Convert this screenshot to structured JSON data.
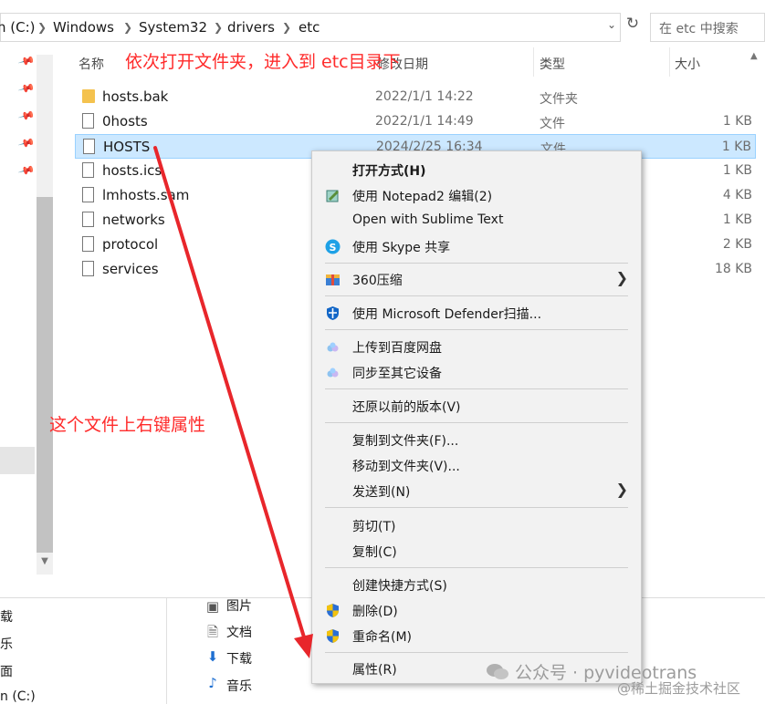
{
  "address": {
    "crumbs": [
      "n (C:)",
      "Windows",
      "System32",
      "drivers",
      "etc"
    ],
    "search_placeholder": "在 etc 中搜索"
  },
  "columns": {
    "name": "名称",
    "date": "修改日期",
    "type": "类型",
    "size": "大小"
  },
  "files": [
    {
      "name": "hosts.bak",
      "date": "2022/1/1 14:22",
      "type": "文件夹",
      "size": ""
    },
    {
      "name": "0hosts",
      "date": "2022/1/1 14:49",
      "type": "文件",
      "size": "1 KB"
    },
    {
      "name": "HOSTS",
      "date": "2024/2/25 16:34",
      "type": "文件",
      "size": "1 KB"
    },
    {
      "name": "hosts.ics",
      "date": "",
      "type": "",
      "size": "1 KB"
    },
    {
      "name": "lmhosts.sam",
      "date": "",
      "type": "",
      "size": "4 KB"
    },
    {
      "name": "networks",
      "date": "",
      "type": "",
      "size": "1 KB"
    },
    {
      "name": "protocol",
      "date": "",
      "type": "",
      "size": "2 KB"
    },
    {
      "name": "services",
      "date": "",
      "type": "",
      "size": "18 KB"
    }
  ],
  "menu": {
    "open_with": "打开方式(H)",
    "notepad2": "使用 Notepad2 编辑(2)",
    "sublime": "Open with Sublime Text",
    "skype": "使用 Skype 共享",
    "zip360": "360压缩",
    "defender": "使用 Microsoft Defender扫描...",
    "baidu_upload": "上传到百度网盘",
    "sync_devices": "同步至其它设备",
    "restore": "还原以前的版本(V)",
    "copy_to": "复制到文件夹(F)...",
    "move_to": "移动到文件夹(V)...",
    "send_to": "发送到(N)",
    "cut": "剪切(T)",
    "copy": "复制(C)",
    "shortcut": "创建快捷方式(S)",
    "delete": "删除(D)",
    "rename": "重命名(M)",
    "properties": "属性(R)"
  },
  "annotations": {
    "top": "依次打开文件夹，进入到 etc目录下",
    "side": "这个文件上右键属性"
  },
  "bottom": {
    "left": [
      "载",
      "乐",
      "面",
      "n (C:)"
    ],
    "items": [
      "图片",
      "文档",
      "下载",
      "音乐"
    ]
  },
  "watermark": {
    "main": "公众号 · pyvideotrans",
    "sub": "@稀土掘金技术社区"
  },
  "colors": {
    "selection": "#cce8ff",
    "annotation": "#ff2b2b"
  }
}
